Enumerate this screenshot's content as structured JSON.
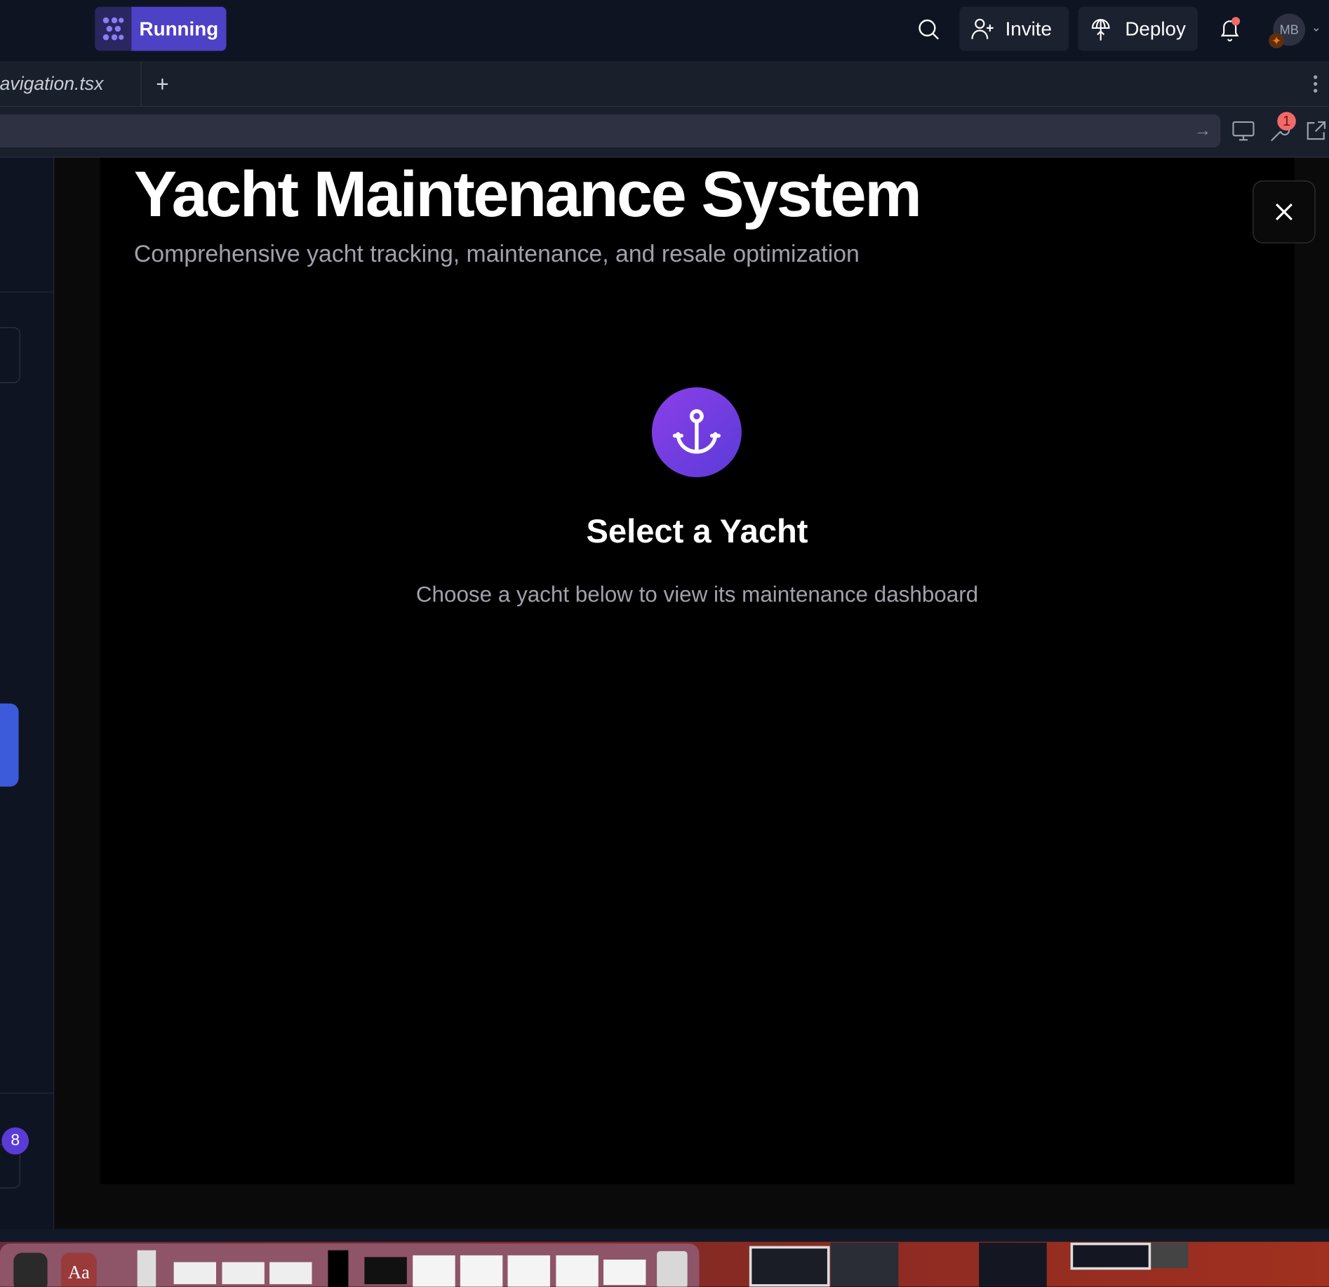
{
  "topbar": {
    "status_label": "Running",
    "invite_label": "Invite",
    "deploy_label": "Deploy",
    "avatar_initials": "MB",
    "notification_color": "#f06a6a"
  },
  "tabs": [
    {
      "label": "avigation.tsx"
    }
  ],
  "devtools": {
    "badge_count": "1"
  },
  "sidebar": {
    "badge_count": "8"
  },
  "app": {
    "title": "Yacht Maintenance System",
    "subtitle": "Comprehensive yacht tracking, maintenance, and resale optimization",
    "empty_state_title": "Select a Yacht",
    "empty_state_description": "Choose a yacht below to view its maintenance dashboard",
    "accent": "#7c3aed"
  },
  "dock": {
    "dictionary_label": "Aa"
  }
}
